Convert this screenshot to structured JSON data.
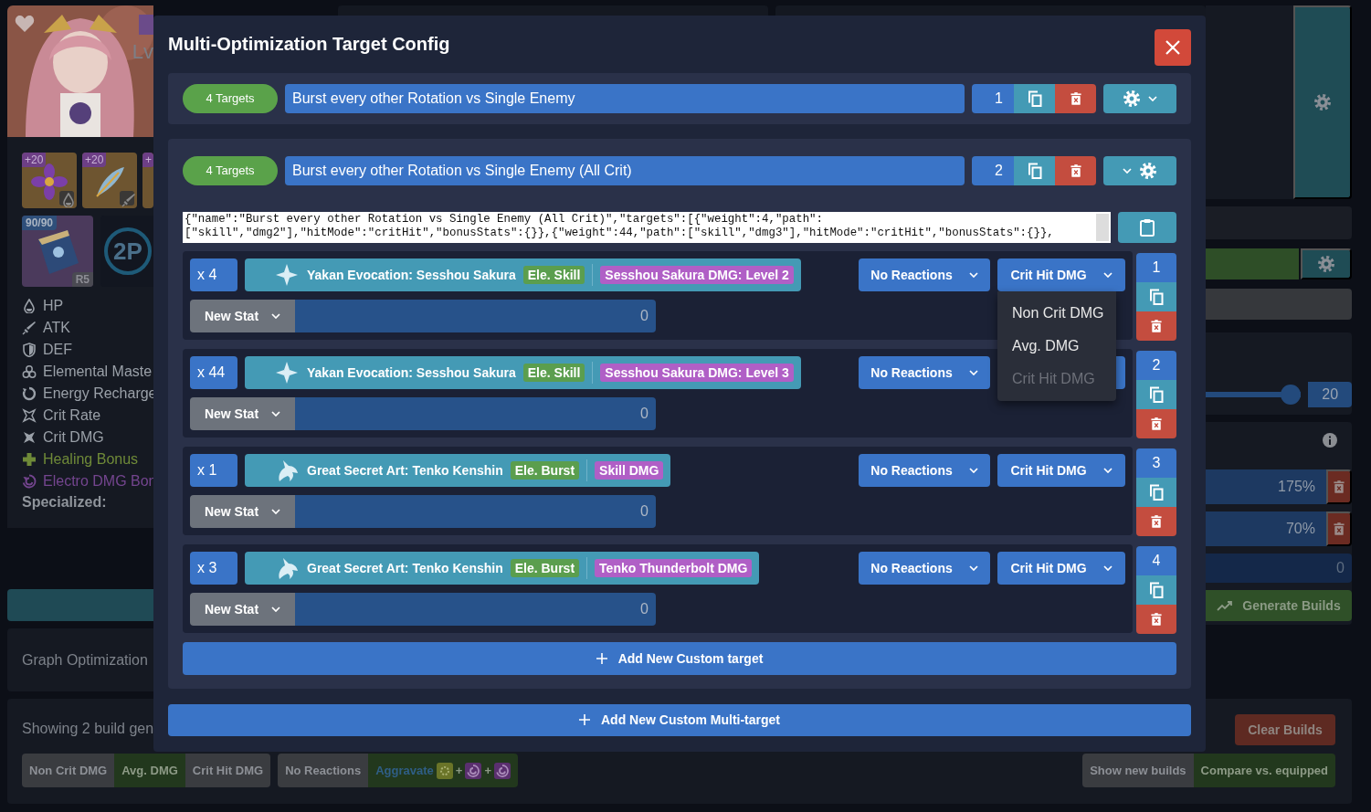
{
  "character": {
    "level_label": "Lv",
    "artifacts": [
      {
        "kind": "flower",
        "level": "+20"
      },
      {
        "kind": "feather",
        "level": "+20"
      },
      {
        "level": "+"
      }
    ],
    "weapon": {
      "level": "90/90",
      "refinement": "R5"
    },
    "set_bonus": "2P",
    "stats": [
      {
        "kind": "hp",
        "label": "HP"
      },
      {
        "kind": "atk",
        "label": "ATK"
      },
      {
        "kind": "def",
        "label": "DEF"
      },
      {
        "kind": "em",
        "label": "Elemental Maste"
      },
      {
        "kind": "er",
        "label": "Energy Recharge"
      },
      {
        "kind": "crit_rate",
        "label": "Crit Rate"
      },
      {
        "kind": "crit_dmg",
        "label": "Crit DMG"
      },
      {
        "kind": "heal",
        "label": "Healing Bonus"
      },
      {
        "kind": "electro",
        "label": "Electro DMG Bon"
      }
    ],
    "specialized": "Specialized:"
  },
  "graph": {
    "title": "Graph Optimization"
  },
  "right_panel": {
    "slider": {
      "level": 1,
      "value": "20"
    },
    "multipliers": [
      {
        "value": "175%"
      },
      {
        "value": "70%"
      }
    ],
    "extra_value": "0",
    "generate": "Generate Builds"
  },
  "builds": {
    "showing": "Showing 2 build gen",
    "clear": "Clear Builds",
    "hit_modes": [
      {
        "label": "Non Crit DMG",
        "selected": false
      },
      {
        "label": "Avg. DMG",
        "selected": true
      },
      {
        "label": "Crit Hit DMG",
        "selected": false
      }
    ],
    "reactions": [
      {
        "label": "No Reactions",
        "selected": false
      },
      {
        "label": "Aggravate",
        "selected": true,
        "joiners": [
          "+",
          "+"
        ]
      }
    ],
    "views": [
      {
        "label": "Show new builds",
        "selected": false
      },
      {
        "label": "Compare vs. equipped",
        "selected": true
      }
    ]
  },
  "modal": {
    "title": "Multi-Optimization Target Config",
    "configs": [
      {
        "count": "4 Targets",
        "name": "Burst every other Rotation vs Single Enemy",
        "order": "1",
        "expanded": false
      },
      {
        "count": "4 Targets",
        "name": "Burst every other Rotation vs Single Enemy (All Crit)",
        "order": "2",
        "expanded": true,
        "json_lines": [
          "{\"name\":\"Burst every other Rotation vs Single Enemy (All Crit)\",\"targets\":[{\"weight\":4,\"path\":",
          "[\"skill\",\"dmg2\"],\"hitMode\":\"critHit\",\"bonusStats\":{}},{\"weight\":44,\"path\":[\"skill\",\"dmg3\"],\"hitMode\":\"critHit\",\"bonusStats\":{}},"
        ],
        "targets": [
          {
            "weight": "x 4",
            "kind": "skill",
            "name": "Yakan Evocation: Sesshou Sakura",
            "tag": "Ele. Skill",
            "detail": "Sesshou Sakura DMG: Level 2",
            "reaction": "No Reactions",
            "hit_mode": "Crit Hit DMG",
            "order": "1",
            "stat": "New Stat",
            "stat_value": "0",
            "menu": [
              {
                "label": "Non Crit DMG",
                "selected": false
              },
              {
                "label": "Avg. DMG",
                "selected": false
              },
              {
                "label": "Crit Hit DMG",
                "selected": true
              }
            ]
          },
          {
            "weight": "x 44",
            "kind": "skill",
            "name": "Yakan Evocation: Sesshou Sakura",
            "tag": "Ele. Skill",
            "detail": "Sesshou Sakura DMG: Level 3",
            "reaction": "No Reactions",
            "order": "2",
            "stat": "New Stat",
            "stat_value": "0"
          },
          {
            "weight": "x 1",
            "kind": "burst",
            "name": "Great Secret Art: Tenko Kenshin",
            "tag": "Ele. Burst",
            "detail": "Skill DMG",
            "reaction": "No Reactions",
            "hit_mode": "Crit Hit DMG",
            "order": "3",
            "stat": "New Stat",
            "stat_value": "0"
          },
          {
            "weight": "x 3",
            "kind": "burst",
            "name": "Great Secret Art: Tenko Kenshin",
            "tag": "Ele. Burst",
            "detail": "Tenko Thunderbolt DMG",
            "reaction": "No Reactions",
            "hit_mode": "Crit Hit DMG",
            "order": "4",
            "stat": "New Stat",
            "stat_value": "0"
          }
        ],
        "add_target": "Add New Custom target"
      }
    ],
    "add_multi": "Add New Custom Multi-target"
  }
}
